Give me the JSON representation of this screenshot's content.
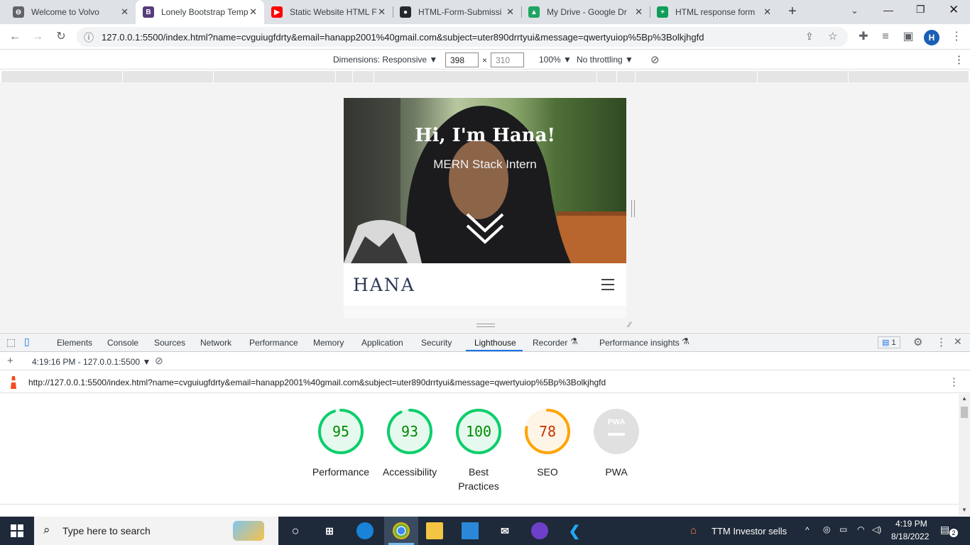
{
  "browser": {
    "tabs": [
      {
        "title": "Welcome to Volvo",
        "favicon": "volvo-icon",
        "color": "#5f6368",
        "glyph": "⊖"
      },
      {
        "title": "Lonely Bootstrap Temp",
        "favicon": "bootstrap-icon",
        "color": "#563d7c",
        "glyph": "B",
        "active": true
      },
      {
        "title": "Static Website HTML F",
        "favicon": "youtube-icon",
        "color": "#ff0000",
        "glyph": "▶"
      },
      {
        "title": "HTML-Form-Submissi",
        "favicon": "github-icon",
        "color": "#24292e",
        "glyph": "●"
      },
      {
        "title": "My Drive - Google Dr",
        "favicon": "drive-icon",
        "color": "#1fa463",
        "glyph": "▲"
      },
      {
        "title": "HTML response form",
        "favicon": "sheets-icon",
        "color": "#0f9d58",
        "glyph": "+"
      }
    ],
    "new_tab": "+",
    "url": "127.0.0.1:5500/index.html?name=cvguiugfdrty&email=hanapp2001%40gmail.com&subject=uter890drrtyui&message=qwertyuiop%5Bp%3Bolkjhgfd",
    "profile_initial": "H"
  },
  "device_toolbar": {
    "dimensions_label": "Dimensions: Responsive",
    "width": "398",
    "height": "310",
    "x": "×",
    "zoom": "100%",
    "throttle": "No throttling"
  },
  "site": {
    "heading": "Hi, I'm Hana!",
    "subheading": "MERN Stack Intern",
    "brand": "HANA"
  },
  "devtools": {
    "tabs": [
      "Elements",
      "Console",
      "Sources",
      "Network",
      "Performance",
      "Memory",
      "Application",
      "Security",
      "Lighthouse",
      "Recorder",
      "Performance insights"
    ],
    "active_tab": "Lighthouse",
    "issues_count": "1",
    "report_selector": "4:19:16 PM - 127.0.0.1:5500",
    "report_url": "http://127.0.0.1:5500/index.html?name=cvguiugfdrty&email=hanapp2001%40gmail.com&subject=uter890drrtyui&message=qwertyuiop%5Bp%3Bolkjhgfd"
  },
  "lighthouse": {
    "scores": [
      {
        "label": "Performance",
        "score": 95,
        "color": "#0cce6b",
        "text": "#008800",
        "fill": "#e6f9ee"
      },
      {
        "label": "Accessibility",
        "score": 93,
        "color": "#0cce6b",
        "text": "#008800",
        "fill": "#e6f9ee"
      },
      {
        "label": "Best Practices",
        "score": 100,
        "color": "#0cce6b",
        "text": "#008800",
        "fill": "#e6f9ee"
      },
      {
        "label": "SEO",
        "score": 78,
        "color": "#ffa400",
        "text": "#c33300",
        "fill": "#fff5e6"
      }
    ],
    "pwa": {
      "label": "PWA",
      "badge": "PWA"
    }
  },
  "taskbar": {
    "search_placeholder": "Type here to search",
    "stock": "TTM  Investor sells",
    "time": "4:19 PM",
    "date": "8/18/2022",
    "notifications": "2"
  }
}
